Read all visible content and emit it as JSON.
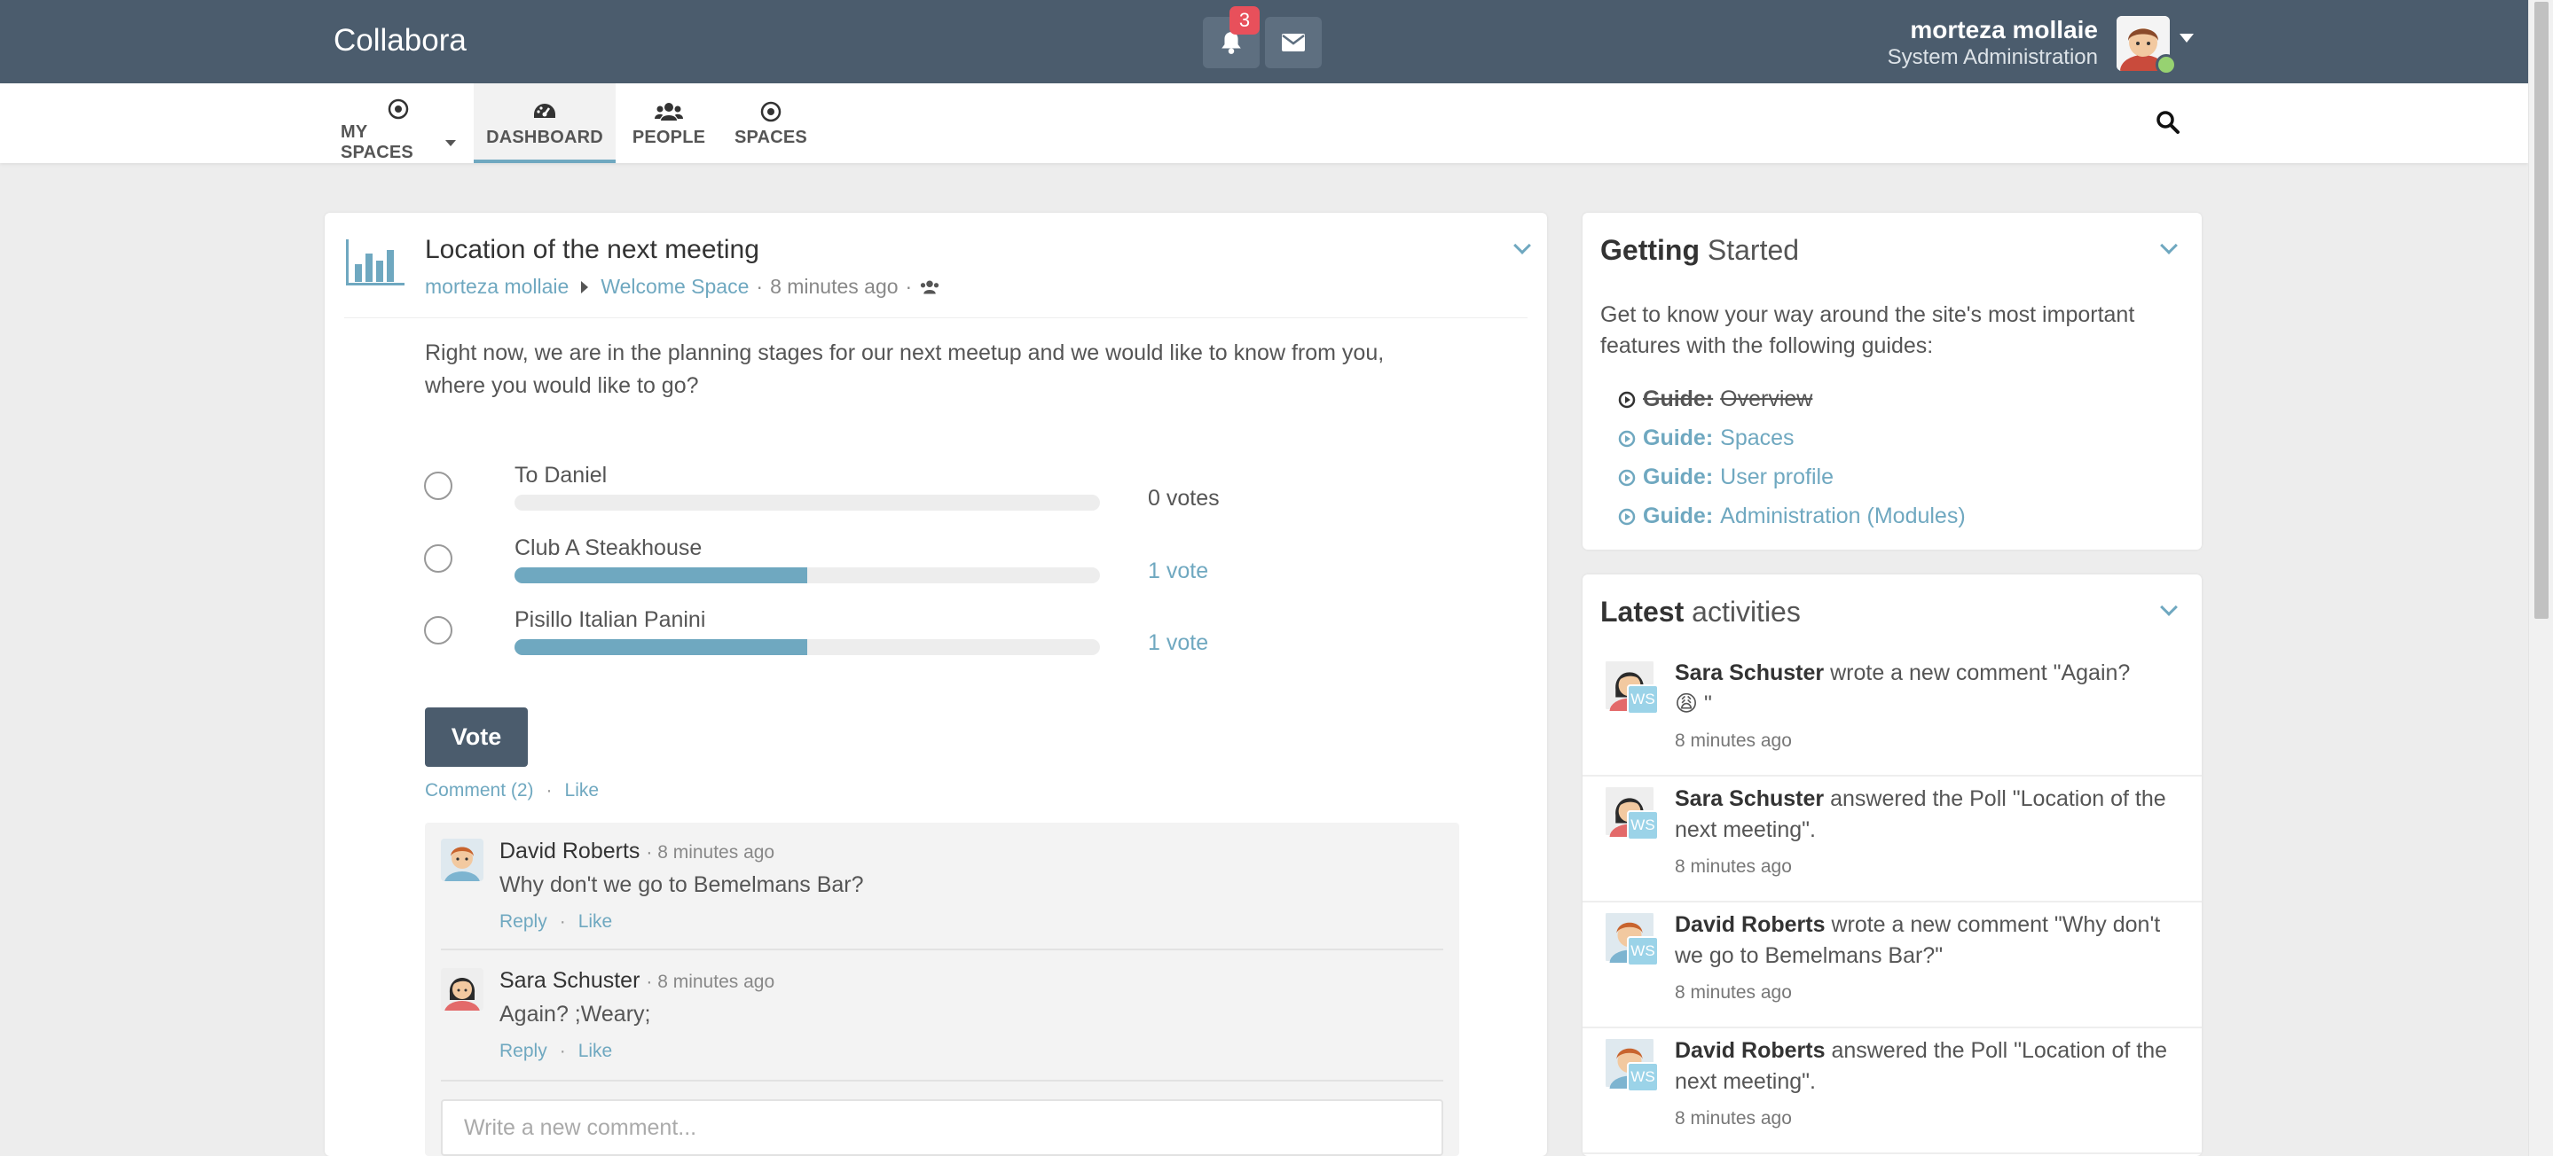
{
  "header": {
    "brand": "Collabora",
    "notification_count": "3",
    "user_name": "morteza mollaie",
    "user_role": "System Administration"
  },
  "nav": {
    "items": [
      {
        "label": "MY SPACES",
        "icon": "circle-dot-icon"
      },
      {
        "label": "DASHBOARD",
        "icon": "dashboard-icon"
      },
      {
        "label": "PEOPLE",
        "icon": "users-icon"
      },
      {
        "label": "SPACES",
        "icon": "circle-dot-icon"
      }
    ],
    "active": "DASHBOARD"
  },
  "poll": {
    "title": "Location of the next meeting",
    "author": "morteza mollaie",
    "space": "Welcome Space",
    "time": "8 minutes ago",
    "question": "Right now, we are in the planning stages for our next meetup and we would like to know from you, where you would like to go?",
    "options": [
      {
        "label": "To Daniel",
        "votes_text": "0 votes",
        "share": 0
      },
      {
        "label": "Club A Steakhouse",
        "votes_text": "1 vote",
        "share": 0.5
      },
      {
        "label": "Pisillo Italian Panini",
        "votes_text": "1 vote",
        "share": 0.5
      }
    ],
    "vote_button": "Vote",
    "comment_link": "Comment (2)",
    "like_link": "Like"
  },
  "comments": [
    {
      "author": "David Roberts",
      "time": "8 minutes ago",
      "text": "Why don't we go to Bemelmans Bar?",
      "reply": "Reply",
      "like": "Like"
    },
    {
      "author": "Sara Schuster",
      "time": "8 minutes ago",
      "text": "Again? ;Weary;",
      "reply": "Reply",
      "like": "Like"
    }
  ],
  "new_comment_placeholder": "Write a new comment...",
  "getting_started": {
    "title_bold": "Getting",
    "title_rest": "Started",
    "intro": "Get to know your way around the site's most important features with the following guides:",
    "guides": [
      {
        "prefix": "Guide:",
        "label": "Overview",
        "done": true
      },
      {
        "prefix": "Guide:",
        "label": "Spaces",
        "done": false
      },
      {
        "prefix": "Guide:",
        "label": "User profile",
        "done": false
      },
      {
        "prefix": "Guide:",
        "label": "Administration (Modules)",
        "done": false
      }
    ]
  },
  "latest_activities": {
    "title_bold": "Latest",
    "title_rest": "activities",
    "items": [
      {
        "user": "Sara Schuster",
        "text": "wrote a new comment \"Again?",
        "text2": "😩 \"",
        "time": "8 minutes ago",
        "badge": "WS"
      },
      {
        "user": "Sara Schuster",
        "text": "answered the Poll \"Location of the next meeting\".",
        "time": "8 minutes ago",
        "badge": "WS"
      },
      {
        "user": "David Roberts",
        "text": "wrote a new comment \"Why don't we go to Bemelmans Bar?\"",
        "time": "8 minutes ago",
        "badge": "WS"
      },
      {
        "user": "David Roberts",
        "text": "answered the Poll \"Location of the next meeting\".",
        "time": "8 minutes ago",
        "badge": "WS"
      }
    ]
  },
  "colors": {
    "header_bg": "#4b5c6d",
    "accent": "#6fa8c0",
    "badge_red": "#e8505b",
    "online_green": "#97d271"
  }
}
